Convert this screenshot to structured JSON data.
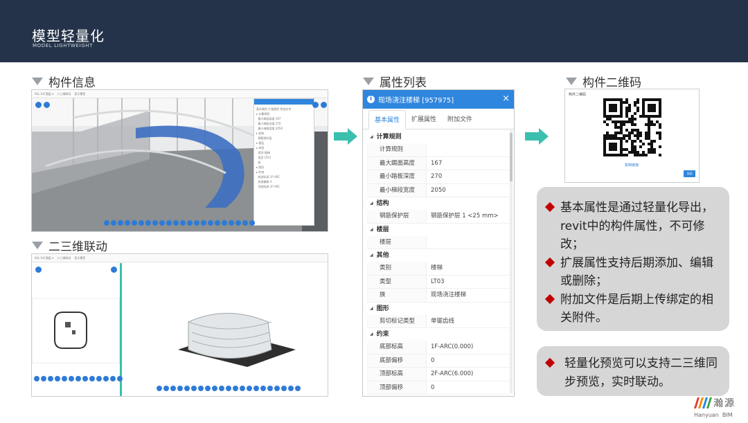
{
  "header": {
    "title": "模型轻量化",
    "subtitle": "MODEL LIGHTWEIGHT"
  },
  "sections": {
    "component_info": "构件信息",
    "linkage": "二三维联动",
    "property_list": "属性列表",
    "qr_code": "构件二维码"
  },
  "property_panel": {
    "title": "现场浇注楼梯 [957975]",
    "close_label": "×",
    "tabs": [
      {
        "label": "基本属性",
        "active": true
      },
      {
        "label": "扩展属性",
        "active": false
      },
      {
        "label": "附加文件",
        "active": false
      }
    ],
    "groups": [
      {
        "name": "计算规则",
        "rows": [
          {
            "key": "计算规则",
            "value": ""
          },
          {
            "key": "最大踢面高度",
            "value": "167"
          },
          {
            "key": "最小踏板深度",
            "value": "270"
          },
          {
            "key": "最小梯段宽度",
            "value": "2050"
          }
        ]
      },
      {
        "name": "结构",
        "rows": [
          {
            "key": "钢筋保护层",
            "value": "钢筋保护层 1 <25 mm>"
          }
        ]
      },
      {
        "name": "楼层",
        "rows": [
          {
            "key": "楼层",
            "value": ""
          }
        ]
      },
      {
        "name": "其他",
        "rows": [
          {
            "key": "类别",
            "value": "楼梯"
          },
          {
            "key": "类型",
            "value": "LT03"
          },
          {
            "key": "族",
            "value": "现场浇注楼梯"
          }
        ]
      },
      {
        "name": "图形",
        "rows": [
          {
            "key": "剪切标记类型",
            "value": "单锯齿线"
          }
        ]
      },
      {
        "name": "约束",
        "rows": [
          {
            "key": "底部标高",
            "value": "1F-ARC(0.000)"
          },
          {
            "key": "底部偏移",
            "value": "0"
          },
          {
            "key": "顶部标高",
            "value": "2F-ARC(6.000)"
          },
          {
            "key": "顶部偏移",
            "value": "0"
          }
        ]
      }
    ]
  },
  "qr_panel": {
    "caption": "构件二维码",
    "link": "复制链接",
    "button": "关闭"
  },
  "callouts": {
    "main": [
      "基本属性是通过轻量化导出，revit中的构件属性，不可修改；",
      "扩展属性支持后期添加、编辑或删除；",
      "附加文件是后期上传绑定的相关附件。"
    ],
    "second": [
      "轻量化预览可以支持二三维同步预览，实时联动。"
    ]
  },
  "logo": {
    "name": "瀚源",
    "sub": "Hanyuan  BIM"
  },
  "colors": {
    "header_bg": "#243349",
    "accent_blue": "#2f86de",
    "arrow": "#3bbfae",
    "bullet": "#c00000"
  }
}
